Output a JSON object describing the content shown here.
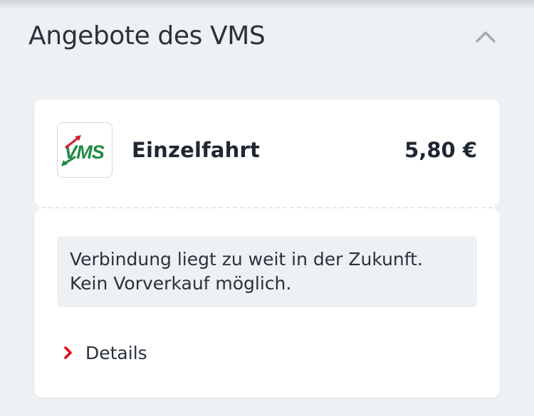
{
  "section": {
    "title": "Angebote des VMS",
    "toggle_icon": "chevron-up-icon"
  },
  "offer": {
    "logo_text": "VMS",
    "logo_colors": {
      "green": "#1f8a43",
      "red": "#d2202f"
    },
    "name": "Einzelfahrt",
    "price": "5,80 €",
    "notice": {
      "line1": "Verbindung liegt zu weit in der Zukunft.",
      "line2": "Kein Vorverkauf möglich."
    },
    "details_label": "Details",
    "details_icon": "chevron-right-icon",
    "accent_color": "#ec0016"
  }
}
